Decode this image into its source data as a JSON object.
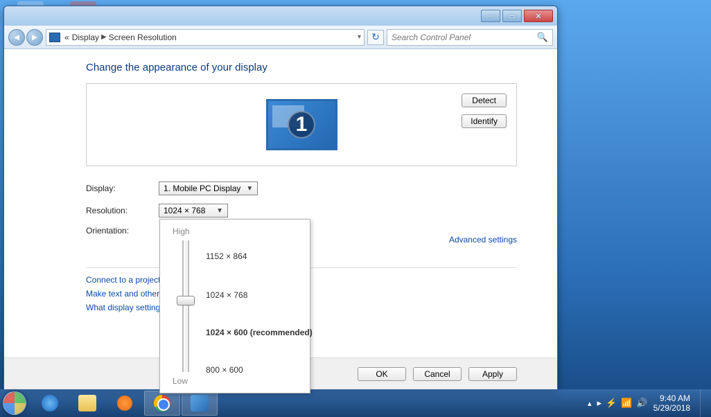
{
  "breadcrumb": {
    "pre": "«",
    "item1": "Display",
    "item2": "Screen Resolution"
  },
  "search_placeholder": "Search Control Panel",
  "page_title": "Change the appearance of your display",
  "monitor_number": "1",
  "buttons": {
    "detect": "Detect",
    "identify": "Identify",
    "ok": "OK",
    "cancel": "Cancel",
    "apply": "Apply"
  },
  "fields": {
    "display_label": "Display:",
    "display_value": "1. Mobile PC Display",
    "resolution_label": "Resolution:",
    "resolution_value": "1024 × 768",
    "orientation_label": "Orientation:"
  },
  "adv_settings": "Advanced settings",
  "links": {
    "projector": "Connect to a projector",
    "textsize": "Make text and other",
    "whatset": "What display setting"
  },
  "slider": {
    "high": "High",
    "low": "Low",
    "opt1": "1152 × 864",
    "opt2": "1024 × 768",
    "opt3": "1024 × 600 (recommended)",
    "opt4": "800 × 600"
  },
  "clock": {
    "time": "9:40 AM",
    "date": "5/29/2018"
  }
}
